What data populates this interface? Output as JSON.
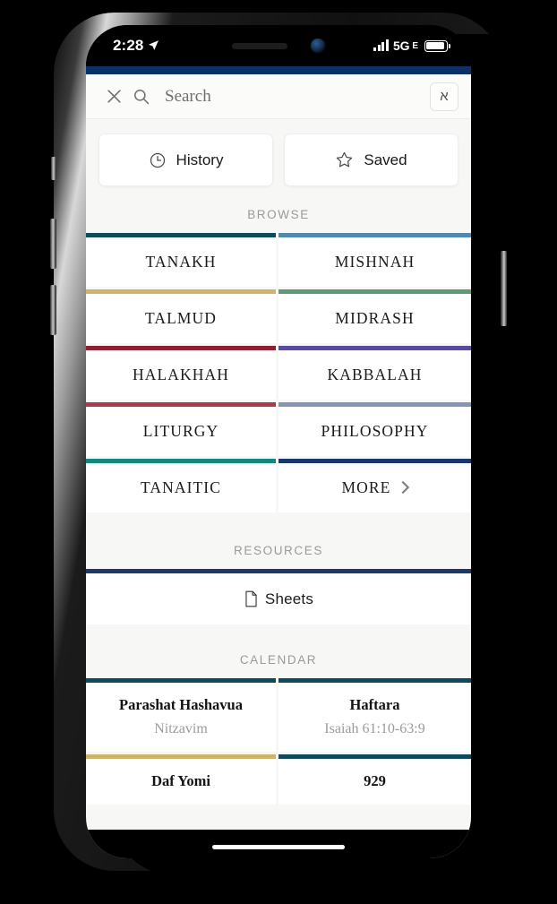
{
  "status_bar": {
    "time": "2:28",
    "location_icon": "location-arrow-icon",
    "network": "5G",
    "network_sub": "E",
    "battery_icon": "battery-icon"
  },
  "header": {
    "close_icon": "close-icon",
    "search_icon": "search-icon",
    "search_placeholder": "Search",
    "language_toggle": "א"
  },
  "quick_actions": [
    {
      "label": "History",
      "icon": "clock-icon"
    },
    {
      "label": "Saved",
      "icon": "star-icon"
    }
  ],
  "sections": {
    "browse": {
      "title": "BROWSE",
      "items": [
        {
          "label": "TANAKH",
          "color": "#0d4a5c",
          "more": false
        },
        {
          "label": "MISHNAH",
          "color": "#5189af",
          "more": false
        },
        {
          "label": "TALMUD",
          "color": "#ceb46a",
          "more": false
        },
        {
          "label": "MIDRASH",
          "color": "#5d9b72",
          "more": false
        },
        {
          "label": "HALAKHAH",
          "color": "#8c2030",
          "more": false
        },
        {
          "label": "KABBALAH",
          "color": "#594a9c",
          "more": false
        },
        {
          "label": "LITURGY",
          "color": "#ac3b4e",
          "more": false
        },
        {
          "label": "PHILOSOPHY",
          "color": "#8394b4",
          "more": false
        },
        {
          "label": "TANAITIC",
          "color": "#11897f",
          "more": false
        },
        {
          "label": "MORE",
          "color": "#18376c",
          "more": true
        }
      ]
    },
    "resources": {
      "title": "RESOURCES",
      "items": [
        {
          "label": "Sheets",
          "color": "#1b3a6b",
          "icon": "document-icon"
        }
      ]
    },
    "calendar": {
      "title": "CALENDAR",
      "items": [
        {
          "title": "Parashat Hashavua",
          "subtitle": "Nitzavim",
          "color": "#0d4a5c"
        },
        {
          "title": "Haftara",
          "subtitle": "Isaiah 61:10-63:9",
          "color": "#0d4a5c"
        },
        {
          "title": "Daf Yomi",
          "subtitle": "",
          "color": "#ceb46a"
        },
        {
          "title": "929",
          "subtitle": "",
          "color": "#0d4a5c"
        }
      ]
    }
  },
  "colors": {
    "navy_strip": "#0b3168",
    "app_background": "#f7f7f5",
    "card_background": "#ffffff"
  }
}
